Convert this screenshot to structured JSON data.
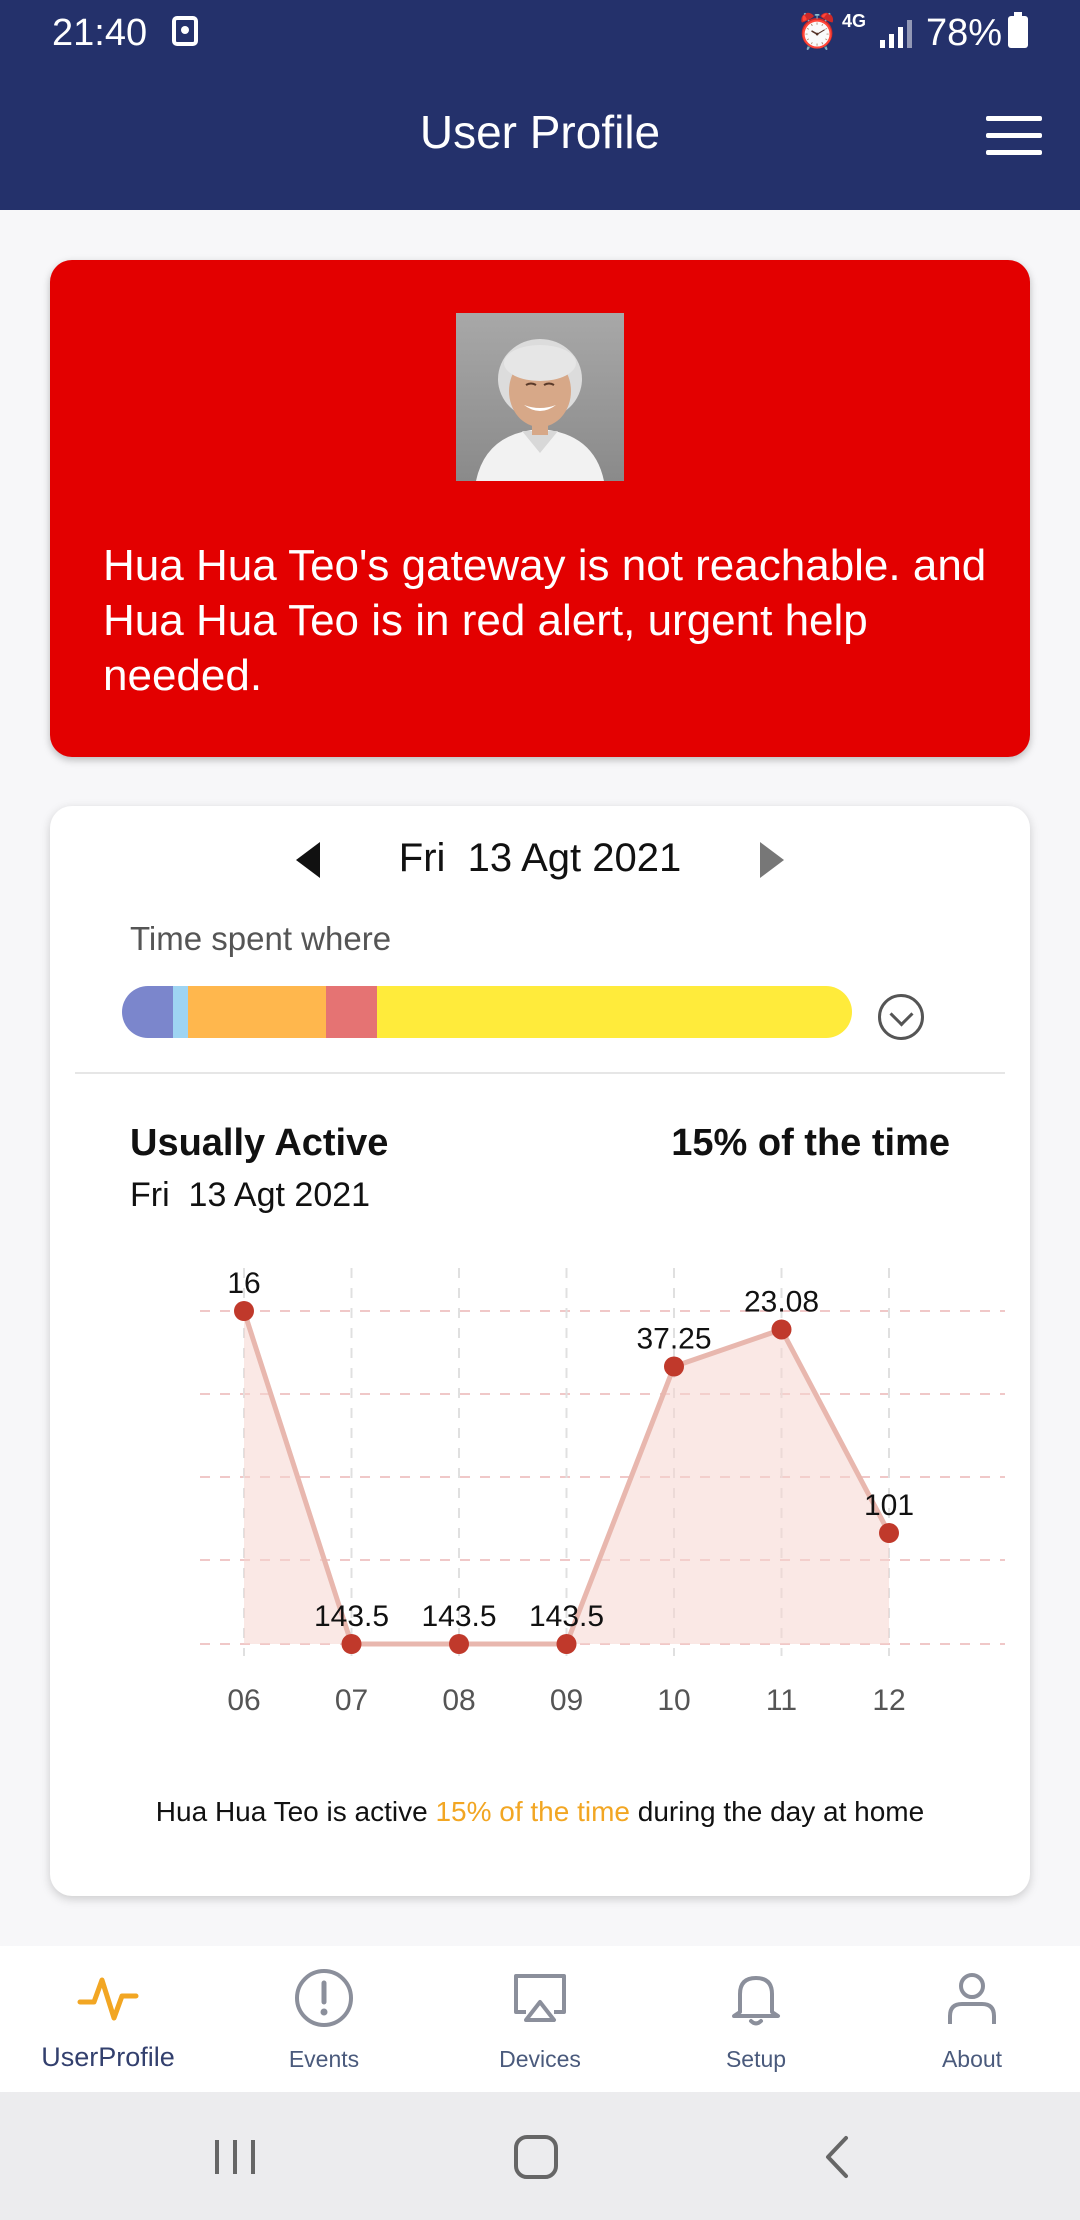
{
  "status_bar": {
    "time": "21:40",
    "network": "4G",
    "battery": "78%"
  },
  "header": {
    "title": "User Profile"
  },
  "alert": {
    "message": "Hua Hua Teo's gateway is not reachable. and Hua Hua Teo is in red alert, urgent help needed.",
    "background_color": "#e30000"
  },
  "activity": {
    "date_label": "Fri  13 Agt 2021",
    "time_spent_label": "Time spent where",
    "time_bar_segments": [
      {
        "color": "#7b86cc",
        "share": 0.07
      },
      {
        "color": "#9ed4f2",
        "share": 0.02
      },
      {
        "color": "#ffb74d",
        "share": 0.19
      },
      {
        "color": "#e57373",
        "share": 0.07
      },
      {
        "color": "#ffeb3b",
        "share": 0.65
      }
    ],
    "usually_active_title": "Usually Active",
    "percent_title": "15% of the time",
    "usually_active_date": "Fri  13 Agt 2021",
    "footer_prefix": "Hua Hua Teo is active ",
    "footer_highlight": "15% of the time",
    "footer_suffix": " during the day at home"
  },
  "chart_data": {
    "type": "line",
    "categories": [
      "06",
      "07",
      "08",
      "09",
      "10",
      "11",
      "12"
    ],
    "values": [
      16,
      143.5,
      143.5,
      143.5,
      37.25,
      23.08,
      101
    ],
    "data_labels": [
      "16",
      "143.5",
      "143.5",
      "143.5",
      "37.25",
      "23.08",
      "101"
    ],
    "y_axis_inverted": true,
    "ylim": [
      16,
      143.5
    ],
    "grid": true,
    "colors": {
      "line": "#e8b7ae",
      "point": "#c0392b",
      "fill": "#f6d5cf"
    }
  },
  "bottom_nav": {
    "items": [
      {
        "label": "UserProfile",
        "icon": "activity-pulse-icon",
        "active": true
      },
      {
        "label": "Events",
        "icon": "alert-circle-icon",
        "active": false
      },
      {
        "label": "Devices",
        "icon": "cast-screen-icon",
        "active": false
      },
      {
        "label": "Setup",
        "icon": "bell-icon",
        "active": false
      },
      {
        "label": "About",
        "icon": "user-icon",
        "active": false
      }
    ]
  }
}
